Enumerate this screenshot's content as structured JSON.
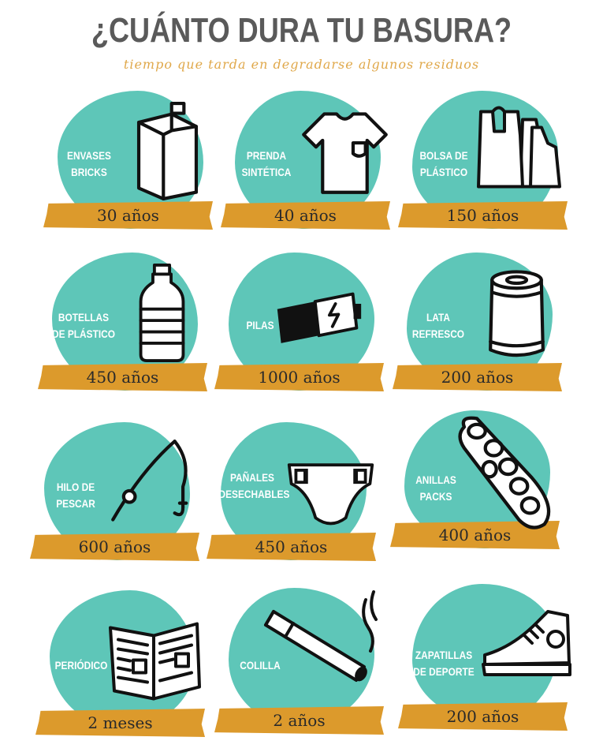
{
  "title": "¿CUÁNTO DURA TU BASURA?",
  "subtitle": "tiempo que tarda en degradarse algunos residuos",
  "items": [
    {
      "line1": "ENVASES",
      "line2": "BRICKS",
      "duration": "30 años",
      "icon": "carton-icon"
    },
    {
      "line1": "PRENDA",
      "line2": "SINTÉTICA",
      "duration": "40 años",
      "icon": "tshirt-icon"
    },
    {
      "line1": "BOLSA DE",
      "line2": "PLÁSTICO",
      "duration": "150 años",
      "icon": "plastic-bag-icon"
    },
    {
      "line1": "BOTELLAS",
      "line2": "DE PLÁSTICO",
      "duration": "450 años",
      "icon": "bottle-icon"
    },
    {
      "line1": "PILAS",
      "line2": "",
      "duration": "1000 años",
      "icon": "battery-icon"
    },
    {
      "line1": "LATA",
      "line2": "REFRESCO",
      "duration": "200 años",
      "icon": "can-icon"
    },
    {
      "line1": "HILO DE",
      "line2": "PESCAR",
      "duration": "600 años",
      "icon": "fishing-rod-icon"
    },
    {
      "line1": "PAÑALES",
      "line2": "DESECHABLES",
      "duration": "450 años",
      "icon": "diaper-icon"
    },
    {
      "line1": "ANILLAS",
      "line2": "PACKS",
      "duration": "400 años",
      "icon": "six-pack-rings-icon"
    },
    {
      "line1": "PERIÓDICO",
      "line2": "",
      "duration": "2 meses",
      "icon": "newspaper-icon"
    },
    {
      "line1": "COLILLA",
      "line2": "",
      "duration": "2 años",
      "icon": "cigarette-icon"
    },
    {
      "line1": "ZAPATILLAS",
      "line2": "DE DEPORTE",
      "duration": "200 años",
      "icon": "sneaker-icon"
    }
  ],
  "colors": {
    "blob": "#5ec6b8",
    "band": "#dc9a2c",
    "title": "#5a5a5a",
    "subtitle": "#e0a84a"
  }
}
